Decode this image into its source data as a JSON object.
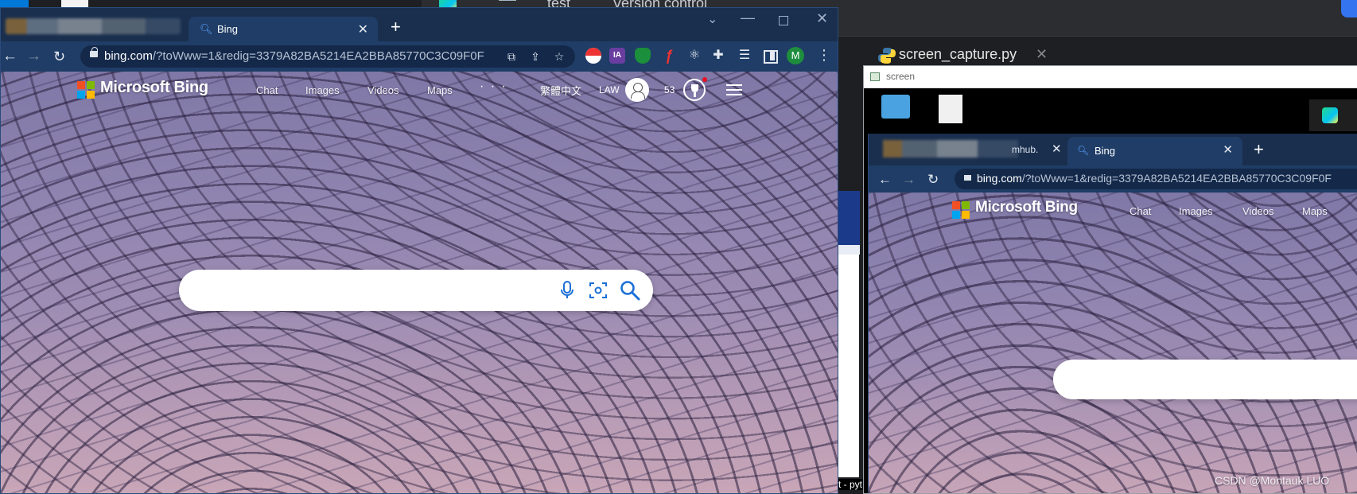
{
  "ide": {
    "project_label": "test",
    "vcs_label": "Version control",
    "file_tab": "screen_capture.py",
    "bottom_fragment": "t - pyt"
  },
  "browser": {
    "tab_title": "Bing",
    "new_tab": "+",
    "url_host": "bing.com",
    "url_path": "/?toWww=1&redig=3379A82BA5214EA2BBA85770C3C09F0F",
    "profile_initial": "M",
    "ext_ia": "IA"
  },
  "bing": {
    "brand": "Microsoft Bing",
    "nav": [
      "Chat",
      "Images",
      "Videos",
      "Maps"
    ],
    "more": "· · ·",
    "language": "繁體中文",
    "user": "LAW",
    "points": "53",
    "search_placeholder": ""
  },
  "screen_window": {
    "title": "screen",
    "tab_suffix": "mhub.",
    "tab_title": "Bing",
    "url_host": "bing.com",
    "url_path": "/?toWww=1&redig=3379A82BA5214EA2BBA85770C3C09F0F",
    "brand": "Microsoft Bing",
    "nav": [
      "Chat",
      "Images",
      "Videos",
      "Maps"
    ]
  },
  "watermark": "CSDN @Montauk LUO"
}
